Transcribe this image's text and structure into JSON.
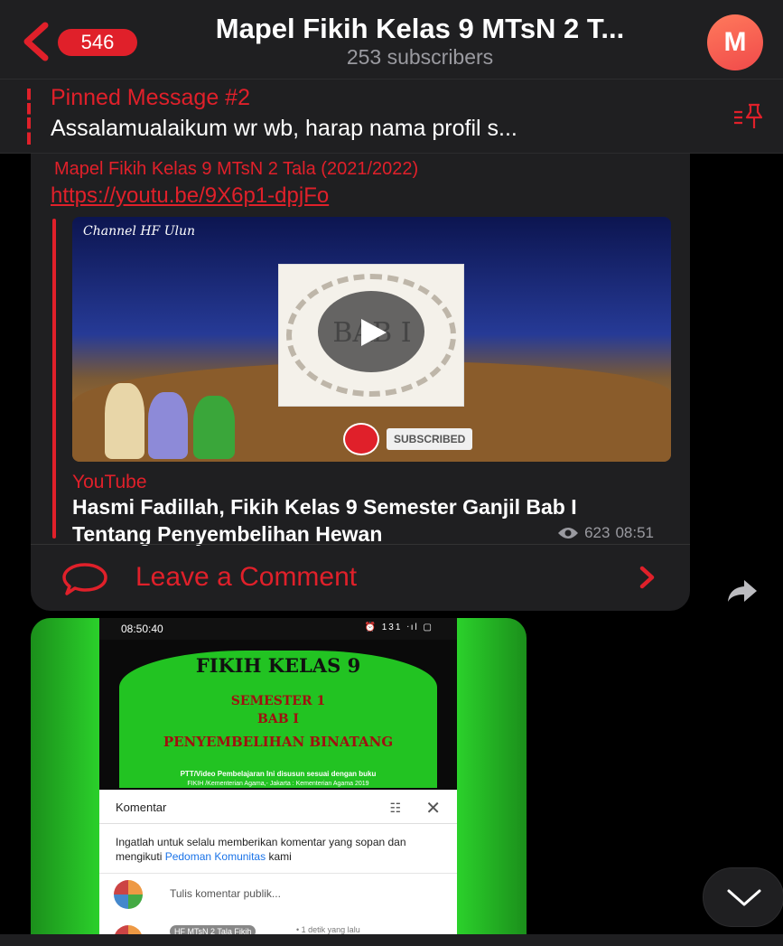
{
  "header": {
    "back_count": "546",
    "title": "Mapel Fikih Kelas 9 MTsN 2 T...",
    "subtitle": "253 subscribers",
    "avatar_letter": "M"
  },
  "pinned": {
    "title": "Pinned Message #2",
    "text": "Assalamualaikum wr wb, harap nama profil s..."
  },
  "message": {
    "author": "Mapel Fikih Kelas 9 MTsN 2 Tala (2021/2022)",
    "link": "https://youtu.be/9X6p1-dpjFo",
    "preview": {
      "channel_watermark": "Channel HF Ulun",
      "card_text": "BAB I",
      "subscribe_label": "SUBSCRIBED",
      "site": "YouTube",
      "title": "Hasmi Fadillah, Fikih Kelas 9 Semester Ganjil Bab I Tentang Penyembelihan Hewan"
    },
    "views": "623",
    "time": "08:51",
    "comment_label": "Leave a Comment"
  },
  "photo": {
    "status_time": "08:50:40",
    "status_icons": "⏰ 131 ᐧıl ▢",
    "slide": {
      "title": "FIKIH KELAS 9",
      "line1": "SEMESTER 1",
      "line2": "BAB I",
      "line3": "PENYEMBELIHAN BINATANG",
      "note1": "PTT/Video Pembelajaran Ini disusun sesuai dengan buku",
      "note2": "FIKIH /Kementerian Agama,- Jakarta : Kementerian Agama 2019"
    },
    "comments": {
      "title": "Komentar",
      "guideline_prefix": "Ingatlah untuk selalu memberikan komentar yang sopan dan mengikuti ",
      "guideline_link": "Pedoman Komunitas",
      "guideline_suffix": " kami",
      "input_placeholder": "Tulis komentar publik...",
      "user": "HF MTsN 2 Tala Fikih",
      "when": "• 1 detik yang lalu"
    }
  },
  "colors": {
    "accent": "#e0202a",
    "header_bg": "#1f1f21",
    "background": "#000000"
  },
  "icons": {
    "back": "chevron-left-icon",
    "pin": "pin-list-icon",
    "views": "eye-icon",
    "comment": "speech-bubble-icon",
    "share": "share-arrow-icon",
    "scroll": "chevron-down-icon"
  }
}
